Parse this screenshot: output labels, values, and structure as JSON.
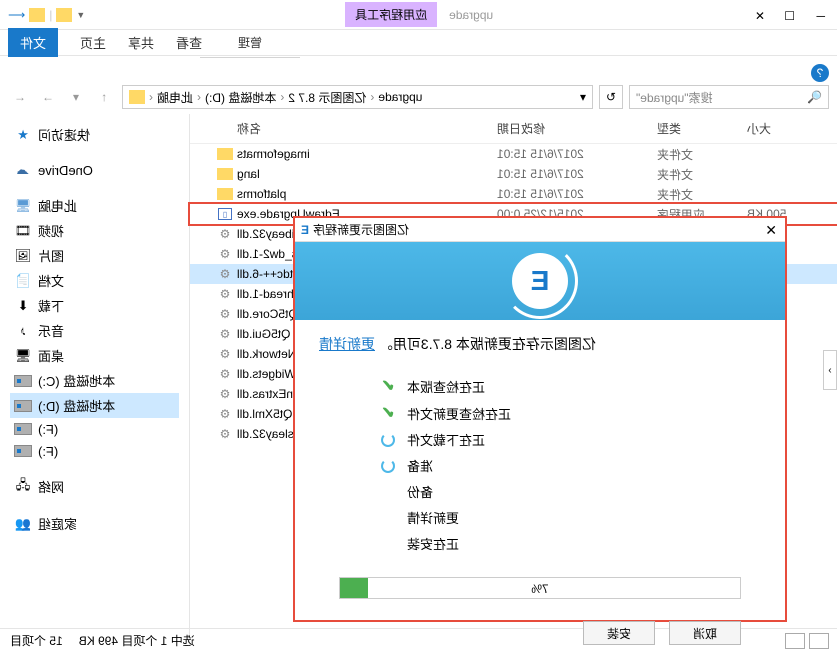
{
  "window": {
    "app_tools_label": "应用程序工具",
    "title_hint": "upgrade",
    "ribbon": {
      "tab_file": "文件",
      "tab_home": "主页",
      "tab_share": "共享",
      "tab_view": "查看",
      "sub_manage": "管理"
    }
  },
  "search": {
    "placeholder": "搜索\"upgrade\""
  },
  "breadcrumb": {
    "items": [
      "此电脑",
      "本地磁盘 (D:)",
      "亿图图示 8.7 2",
      "upgrade"
    ]
  },
  "sidebar": {
    "quick_access": "快速访问",
    "onedrive": "OneDrive",
    "this_pc": "此电脑",
    "videos": "视频",
    "pictures": "图片",
    "documents": "文档",
    "downloads": "下载",
    "music": "音乐",
    "desktop": "桌面",
    "drive_c": "本地磁盘 (C:)",
    "drive_d": "本地磁盘 (D:)",
    "drive_f1": "(F:)",
    "drive_f2": "(F:)",
    "network": "网络",
    "homegroup": "家庭组"
  },
  "columns": {
    "name": "名称",
    "date": "修改日期",
    "type": "类型",
    "size": "大小"
  },
  "files": [
    {
      "name": "imageformats",
      "date": "2017/6/15 15:01",
      "type": "文件夹",
      "size": "",
      "icon": "folder"
    },
    {
      "name": "lang",
      "date": "2017/6/15 15:01",
      "type": "文件夹",
      "size": "",
      "icon": "folder"
    },
    {
      "name": "platforms",
      "date": "2017/6/15 15:01",
      "type": "文件夹",
      "size": "",
      "icon": "folder"
    },
    {
      "name": "EdrawUpgrade.exe",
      "date": "2015/12/25 0:00",
      "type": "应用程序",
      "size": "500 KB",
      "icon": "exe",
      "highlight": true
    },
    {
      "name": "libeay32.dll",
      "icon": "dll"
    },
    {
      "name": "libgcc_s_dw2-1.dll",
      "icon": "dll"
    },
    {
      "name": "libstdc++-6.dll",
      "icon": "dll",
      "selected": true
    },
    {
      "name": "libwinpthread-1.dll",
      "icon": "dll"
    },
    {
      "name": "Qt5Core.dll",
      "icon": "dll"
    },
    {
      "name": "Qt5Gui.dll",
      "icon": "dll"
    },
    {
      "name": "Qt5Network.dll",
      "icon": "dll"
    },
    {
      "name": "Qt5Widgets.dll",
      "icon": "dll"
    },
    {
      "name": "Qt5WinExtras.dll",
      "icon": "dll"
    },
    {
      "name": "Qt5Xml.dll",
      "icon": "dll"
    },
    {
      "name": "ssleay32.dll",
      "icon": "dll"
    }
  ],
  "status": {
    "count": "15 个项目",
    "sel": "选中 1 个项目 499 KB"
  },
  "dialog": {
    "title": "亿图图示更新程序",
    "message_pre": "亿图图示存在更新版本 8.7.3可用。",
    "link": "更新详情",
    "steps": {
      "s1": "正在检查版本",
      "s2": "正在检查更新文件",
      "s3": "正在下载文件",
      "s4": "准备",
      "s5": "备份",
      "s6": "更新详情",
      "s7": "正在安装"
    },
    "progress_text": "7%",
    "progress_value": 7,
    "btn_install": "安装",
    "btn_cancel": "取消"
  }
}
